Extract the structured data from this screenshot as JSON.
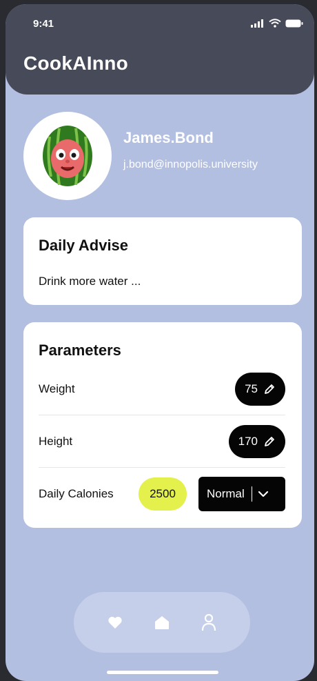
{
  "status_bar": {
    "time": "9:41"
  },
  "app": {
    "title": "CookAInno"
  },
  "profile": {
    "name": "James.Bond",
    "email": "j.bond@innopolis.university",
    "avatar_icon": "watermelon-avatar-icon"
  },
  "advise": {
    "title": "Daily Advise",
    "text": "Drink more water ..."
  },
  "parameters": {
    "title": "Parameters",
    "weight": {
      "label": "Weight",
      "value": "75"
    },
    "height": {
      "label": "Height",
      "value": "170"
    },
    "calories": {
      "label": "Daily Calonies",
      "value": "2500",
      "mode": "Normal"
    }
  },
  "nav": {
    "items": [
      "heart-icon",
      "home-icon",
      "user-icon"
    ]
  },
  "colors": {
    "background": "#b3bfe1",
    "header": "#474a59",
    "calories_highlight": "#e4f04c",
    "pill": "#050505"
  }
}
